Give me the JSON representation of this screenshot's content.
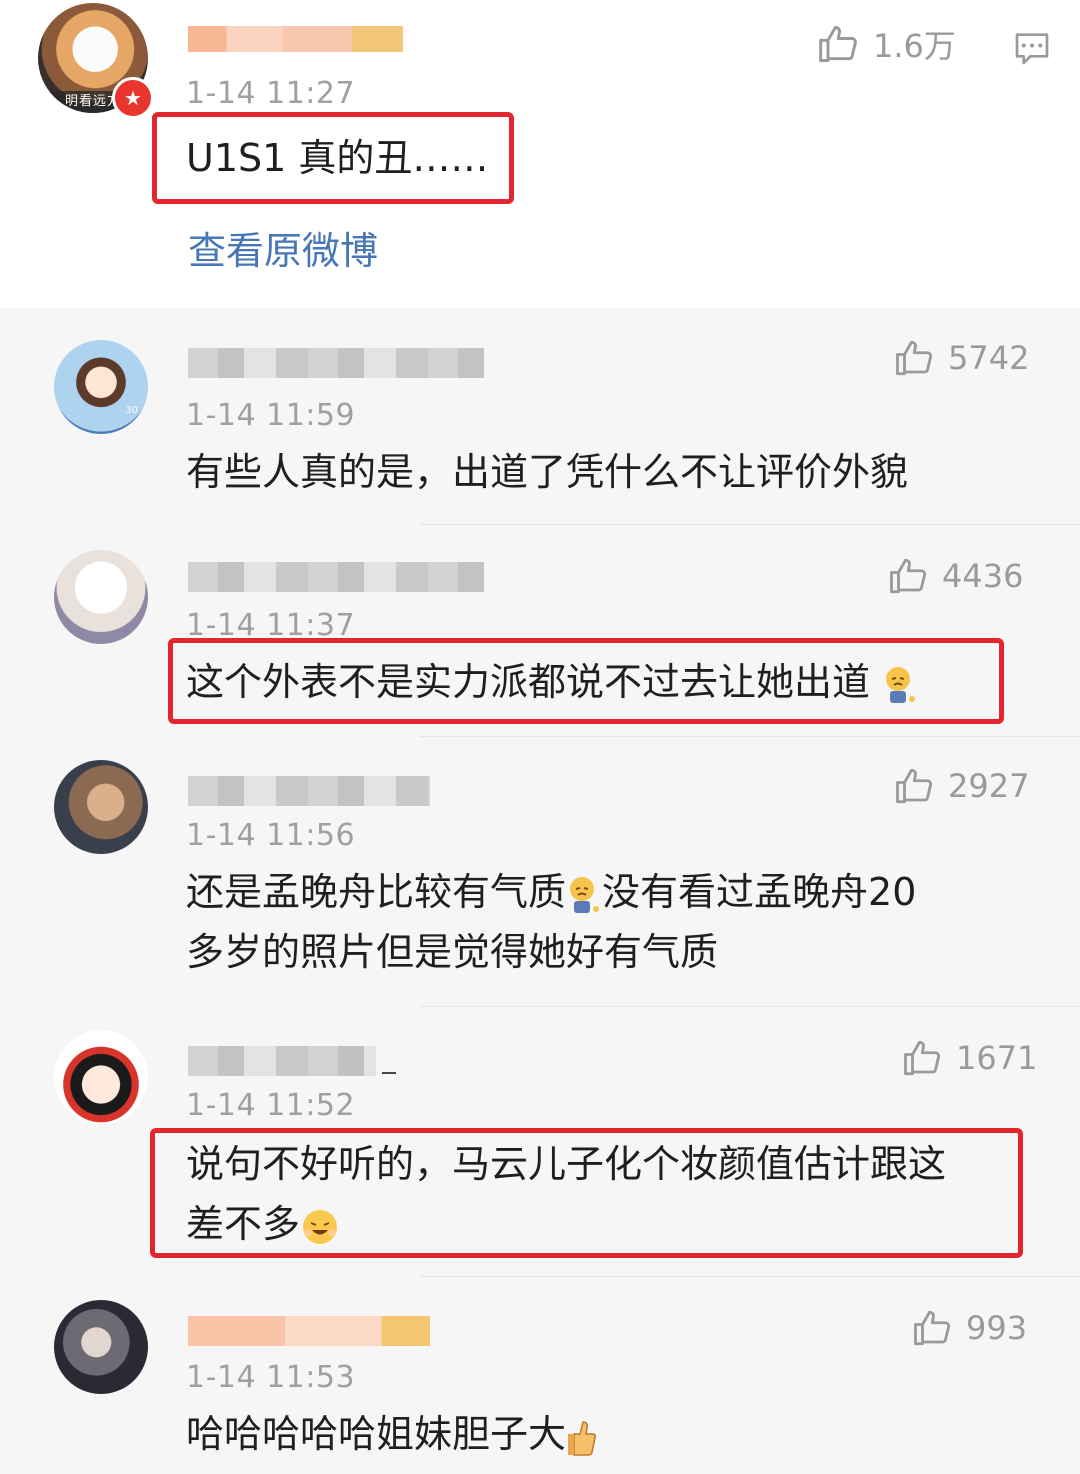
{
  "main_comment": {
    "time": "1-14 11:27",
    "text": "U1S1 真的丑……",
    "likes": "1.6万",
    "view_original": "查看原微博",
    "avatar_band": "明看远方"
  },
  "replies": [
    {
      "time": "1-14 11:59",
      "likes": "5742",
      "text": "有些人真的是，出道了凭什么不让评价外貌"
    },
    {
      "time": "1-14 11:37",
      "likes": "4436",
      "text": "这个外表不是实力派都说不过去让她出道",
      "emoji": "sad-face-emoji"
    },
    {
      "time": "1-14 11:56",
      "likes": "2927",
      "text_line1_a": "还是孟晚舟比较有气质",
      "text_line1_b": "没有看过孟晚舟20",
      "text_line2": "多岁的照片但是觉得她好有气质",
      "emoji": "sad-face-emoji"
    },
    {
      "time": "1-14 11:52",
      "likes": "1671",
      "text_line1": "说句不好听的，马云儿子化个妆颜值估计跟这",
      "text_line2": "差不多",
      "emoji": "laughing-face-emoji"
    },
    {
      "time": "1-14 11:53",
      "likes": "993",
      "text": "哈哈哈哈哈姐妹胆子大",
      "emoji": "thumbs-up-emoji"
    }
  ],
  "icons": {
    "like": "thumbs-up-icon",
    "comment": "comment-icon",
    "verified": "verified-badge-icon"
  },
  "colors": {
    "highlight_box": "#e3262e",
    "link": "#4777b5",
    "timestamp": "#a0a0a0"
  }
}
